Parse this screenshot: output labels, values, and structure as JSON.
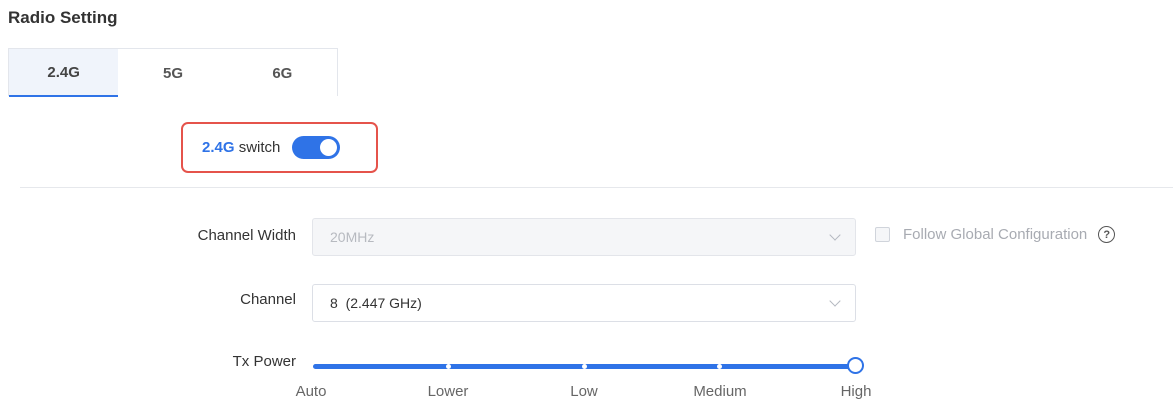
{
  "section_title": "Radio Setting",
  "tabs": [
    {
      "label": "2.4G",
      "active": true
    },
    {
      "label": "5G",
      "active": false
    },
    {
      "label": "6G",
      "active": false
    }
  ],
  "switch": {
    "band": "2.4G",
    "label": "switch",
    "enabled": true
  },
  "channel_width": {
    "label": "Channel Width",
    "value": "20MHz",
    "disabled": true,
    "follow_global": {
      "label": "Follow Global Configuration",
      "checked": false
    }
  },
  "channel": {
    "label": "Channel",
    "value": "8  (2.447 GHz)"
  },
  "tx_power": {
    "label": "Tx Power",
    "marks": [
      "Auto",
      "Lower",
      "Low",
      "Medium",
      "High"
    ],
    "selected": "High"
  },
  "colors": {
    "accent": "#2f73e7",
    "highlight_border": "#e5534b"
  },
  "icons": {
    "help": "help-icon",
    "dropdown": "chevron-down-icon"
  }
}
